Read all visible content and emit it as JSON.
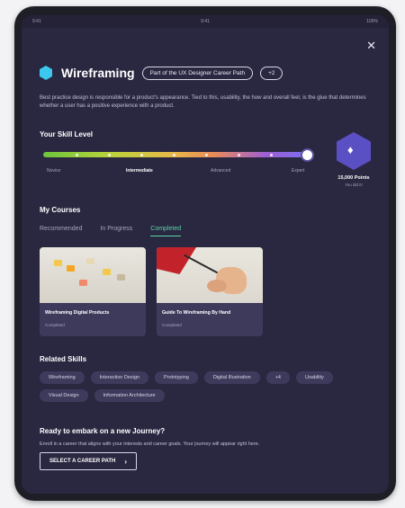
{
  "status": {
    "left": "9:41",
    "center": "9:41",
    "right": "100%"
  },
  "header": {
    "title": "Wireframing",
    "career_pill": "Part of the UX Designer Career Path",
    "count_pill": "+2",
    "description": "Best practice design is responsible for a product's appearance. Tied to this, usability, the how and overall feel, is the glue that determines whether a user has a positive experience with a product."
  },
  "skill": {
    "title": "Your Skill Level",
    "levels": [
      "Novice",
      "Intermediate",
      "Advanced",
      "Expert"
    ],
    "active_level": "Intermediate",
    "progress": 0.98,
    "badge_points": "15,000 Points",
    "badge_sub": "You did it!"
  },
  "courses": {
    "title": "My Courses",
    "tabs": [
      "Recommended",
      "In Progress",
      "Completed"
    ],
    "active_tab": "Completed",
    "items": [
      {
        "title": "Wireframing Digital Products",
        "status": "Completed"
      },
      {
        "title": "Guide To Wireframing By Hand",
        "status": "Completed"
      }
    ]
  },
  "related": {
    "title": "Related Skills",
    "chips": [
      "Wireframing",
      "Interaction Design",
      "Prototyping",
      "Digital Illustration",
      "+4",
      "Usability",
      "Visual Design",
      "Information Architecture"
    ]
  },
  "journey": {
    "title": "Ready to embark on a new Journey?",
    "description": "Enroll in a career that aligns with your interests and career goals. Your journey will appear right here.",
    "cta": "SELECT A CAREER PATH"
  },
  "colors": {
    "accent": "#58d6a8",
    "hex": "#3cc8ee",
    "badge": "#5b4fc4",
    "background": "#2a2740"
  }
}
